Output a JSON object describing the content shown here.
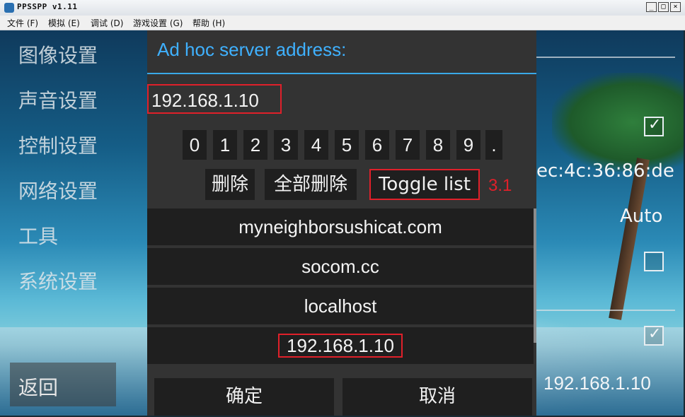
{
  "window": {
    "title": "PPSSPP v1.11",
    "controls": [
      "_",
      "□",
      "×"
    ]
  },
  "menubar": {
    "items": [
      "文件 (F)",
      "模拟 (E)",
      "调试 (D)",
      "游戏设置 (G)",
      "帮助 (H)"
    ]
  },
  "sidebar": {
    "items": [
      "图像设置",
      "声音设置",
      "控制设置",
      "网络设置",
      "工具",
      "系统设置"
    ],
    "back_label": "返回"
  },
  "right_panel": {
    "mac_text": "ec:4c:36:86:de",
    "auto_text": "Auto",
    "ip_text": "192.168.1.10",
    "checkboxes": [
      {
        "checked": true
      },
      {
        "checked": false
      },
      {
        "checked": true
      }
    ]
  },
  "dialog": {
    "title": "Ad hoc server address:",
    "input_value": "192.168.1.10",
    "keys": [
      "0",
      "1",
      "2",
      "3",
      "4",
      "5",
      "6",
      "7",
      "8",
      "9",
      "."
    ],
    "delete_label": "删除",
    "delete_all_label": "全部删除",
    "toggle_list_label": "Toggle list",
    "annotation": "3.1",
    "server_list": [
      "myneighborsushicat.com",
      "socom.cc",
      "localhost",
      "192.168.1.10"
    ],
    "ok_label": "确定",
    "cancel_label": "取消"
  },
  "colors": {
    "accent_blue": "#3fb1ff",
    "highlight_red": "#e0202a",
    "dialog_bg": "#333333",
    "button_bg": "#1f1f1f"
  }
}
